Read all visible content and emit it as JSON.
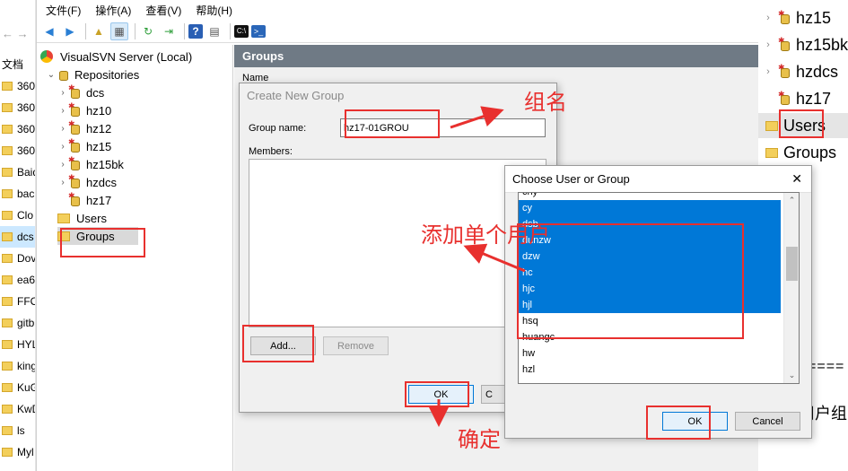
{
  "background_left": {
    "doc_label": "文档",
    "folders": [
      "360",
      "360",
      "360",
      "360",
      "Baid",
      "bac",
      "Clo",
      "dcs",
      "Dov",
      "ea6",
      "FFO",
      "gitb",
      "HYL",
      "king",
      "KuG",
      "KwD",
      "ls",
      "Myl"
    ]
  },
  "menu": [
    "文件(F)",
    "操作(A)",
    "查看(V)",
    "帮助(H)"
  ],
  "tree": {
    "server": "VisualSVN Server (Local)",
    "repositories_label": "Repositories",
    "repos": [
      "dcs",
      "hz10",
      "hz12",
      "hz15",
      "hz15bk",
      "hzdcs",
      "hz17"
    ],
    "users_label": "Users",
    "groups_label": "Groups"
  },
  "right_pane": {
    "header": "Groups",
    "name_col": "Name"
  },
  "create_group": {
    "title": "Create New Group",
    "group_name_label": "Group name:",
    "group_name_value": "hz17-01GROU",
    "members_label": "Members:",
    "add_label": "Add...",
    "remove_label": "Remove",
    "ok_label": "OK",
    "cancel_peek": "C"
  },
  "choose_user": {
    "title": "Choose User or Group",
    "close_glyph": "✕",
    "items": [
      {
        "label": "chy",
        "selected": false
      },
      {
        "label": "cy",
        "selected": true
      },
      {
        "label": "dsb",
        "selected": true
      },
      {
        "label": "dunzw",
        "selected": true
      },
      {
        "label": "dzw",
        "selected": true
      },
      {
        "label": "hc",
        "selected": true
      },
      {
        "label": "hjc",
        "selected": true
      },
      {
        "label": "hjl",
        "selected": true
      },
      {
        "label": "hsq",
        "selected": false
      },
      {
        "label": "huangc",
        "selected": false
      },
      {
        "label": "hw",
        "selected": false
      },
      {
        "label": "hzl",
        "selected": false
      }
    ],
    "ok_label": "OK",
    "cancel_label": "Cancel"
  },
  "background_right": {
    "items": [
      "hz15",
      "hz15bk",
      "hzdcs",
      "hz17"
    ],
    "users": "Users",
    "groups": "Groups",
    "dashes": "====",
    "peek_text": "用户组"
  },
  "annotations": {
    "group_name": "组名",
    "add_single_user": "添加单个用户",
    "confirm": "确定",
    "color": "#e8302e"
  }
}
